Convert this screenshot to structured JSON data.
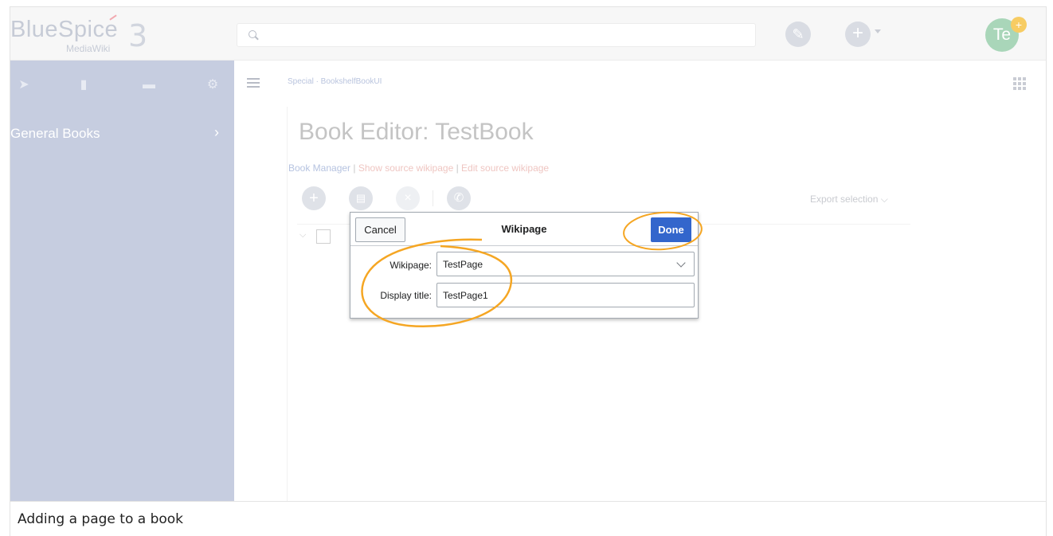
{
  "header": {
    "logo_main": "BlueSpice",
    "logo_sub": "MediaWiki",
    "logo_version": "3",
    "avatar_initials": "Te",
    "avatar_badge": "+",
    "edit_icon": "pencil-icon",
    "add_icon": "plus-icon"
  },
  "sidebar": {
    "icons": [
      "navigation-icon",
      "book-icon",
      "clipboard-icon",
      "gear-icon"
    ],
    "items": [
      {
        "label": "General Books"
      }
    ]
  },
  "main": {
    "breadcrumb": "Special · BookshelfBookUI",
    "title": "Book Editor: TestBook",
    "links": {
      "book_manager": "Book Manager",
      "separator": " | ",
      "show_source": "Show source wikipage",
      "edit_source": "Edit source wikipage"
    },
    "toolbar": {
      "icons": [
        "add-icon",
        "add-multiple-icon",
        "remove-icon",
        "wrench-icon"
      ],
      "export_label": "Export selection"
    }
  },
  "dialog": {
    "title": "Wikipage",
    "cancel_label": "Cancel",
    "done_label": "Done",
    "wikipage_label": "Wikipage:",
    "wikipage_value": "TestPage",
    "display_title_label": "Display title:",
    "display_title_value": "TestPage1"
  },
  "caption": "Adding a page to a book",
  "colors": {
    "sidebar": "#c6cde0",
    "primary_button": "#3366cc",
    "annotation": "#f5a623"
  }
}
